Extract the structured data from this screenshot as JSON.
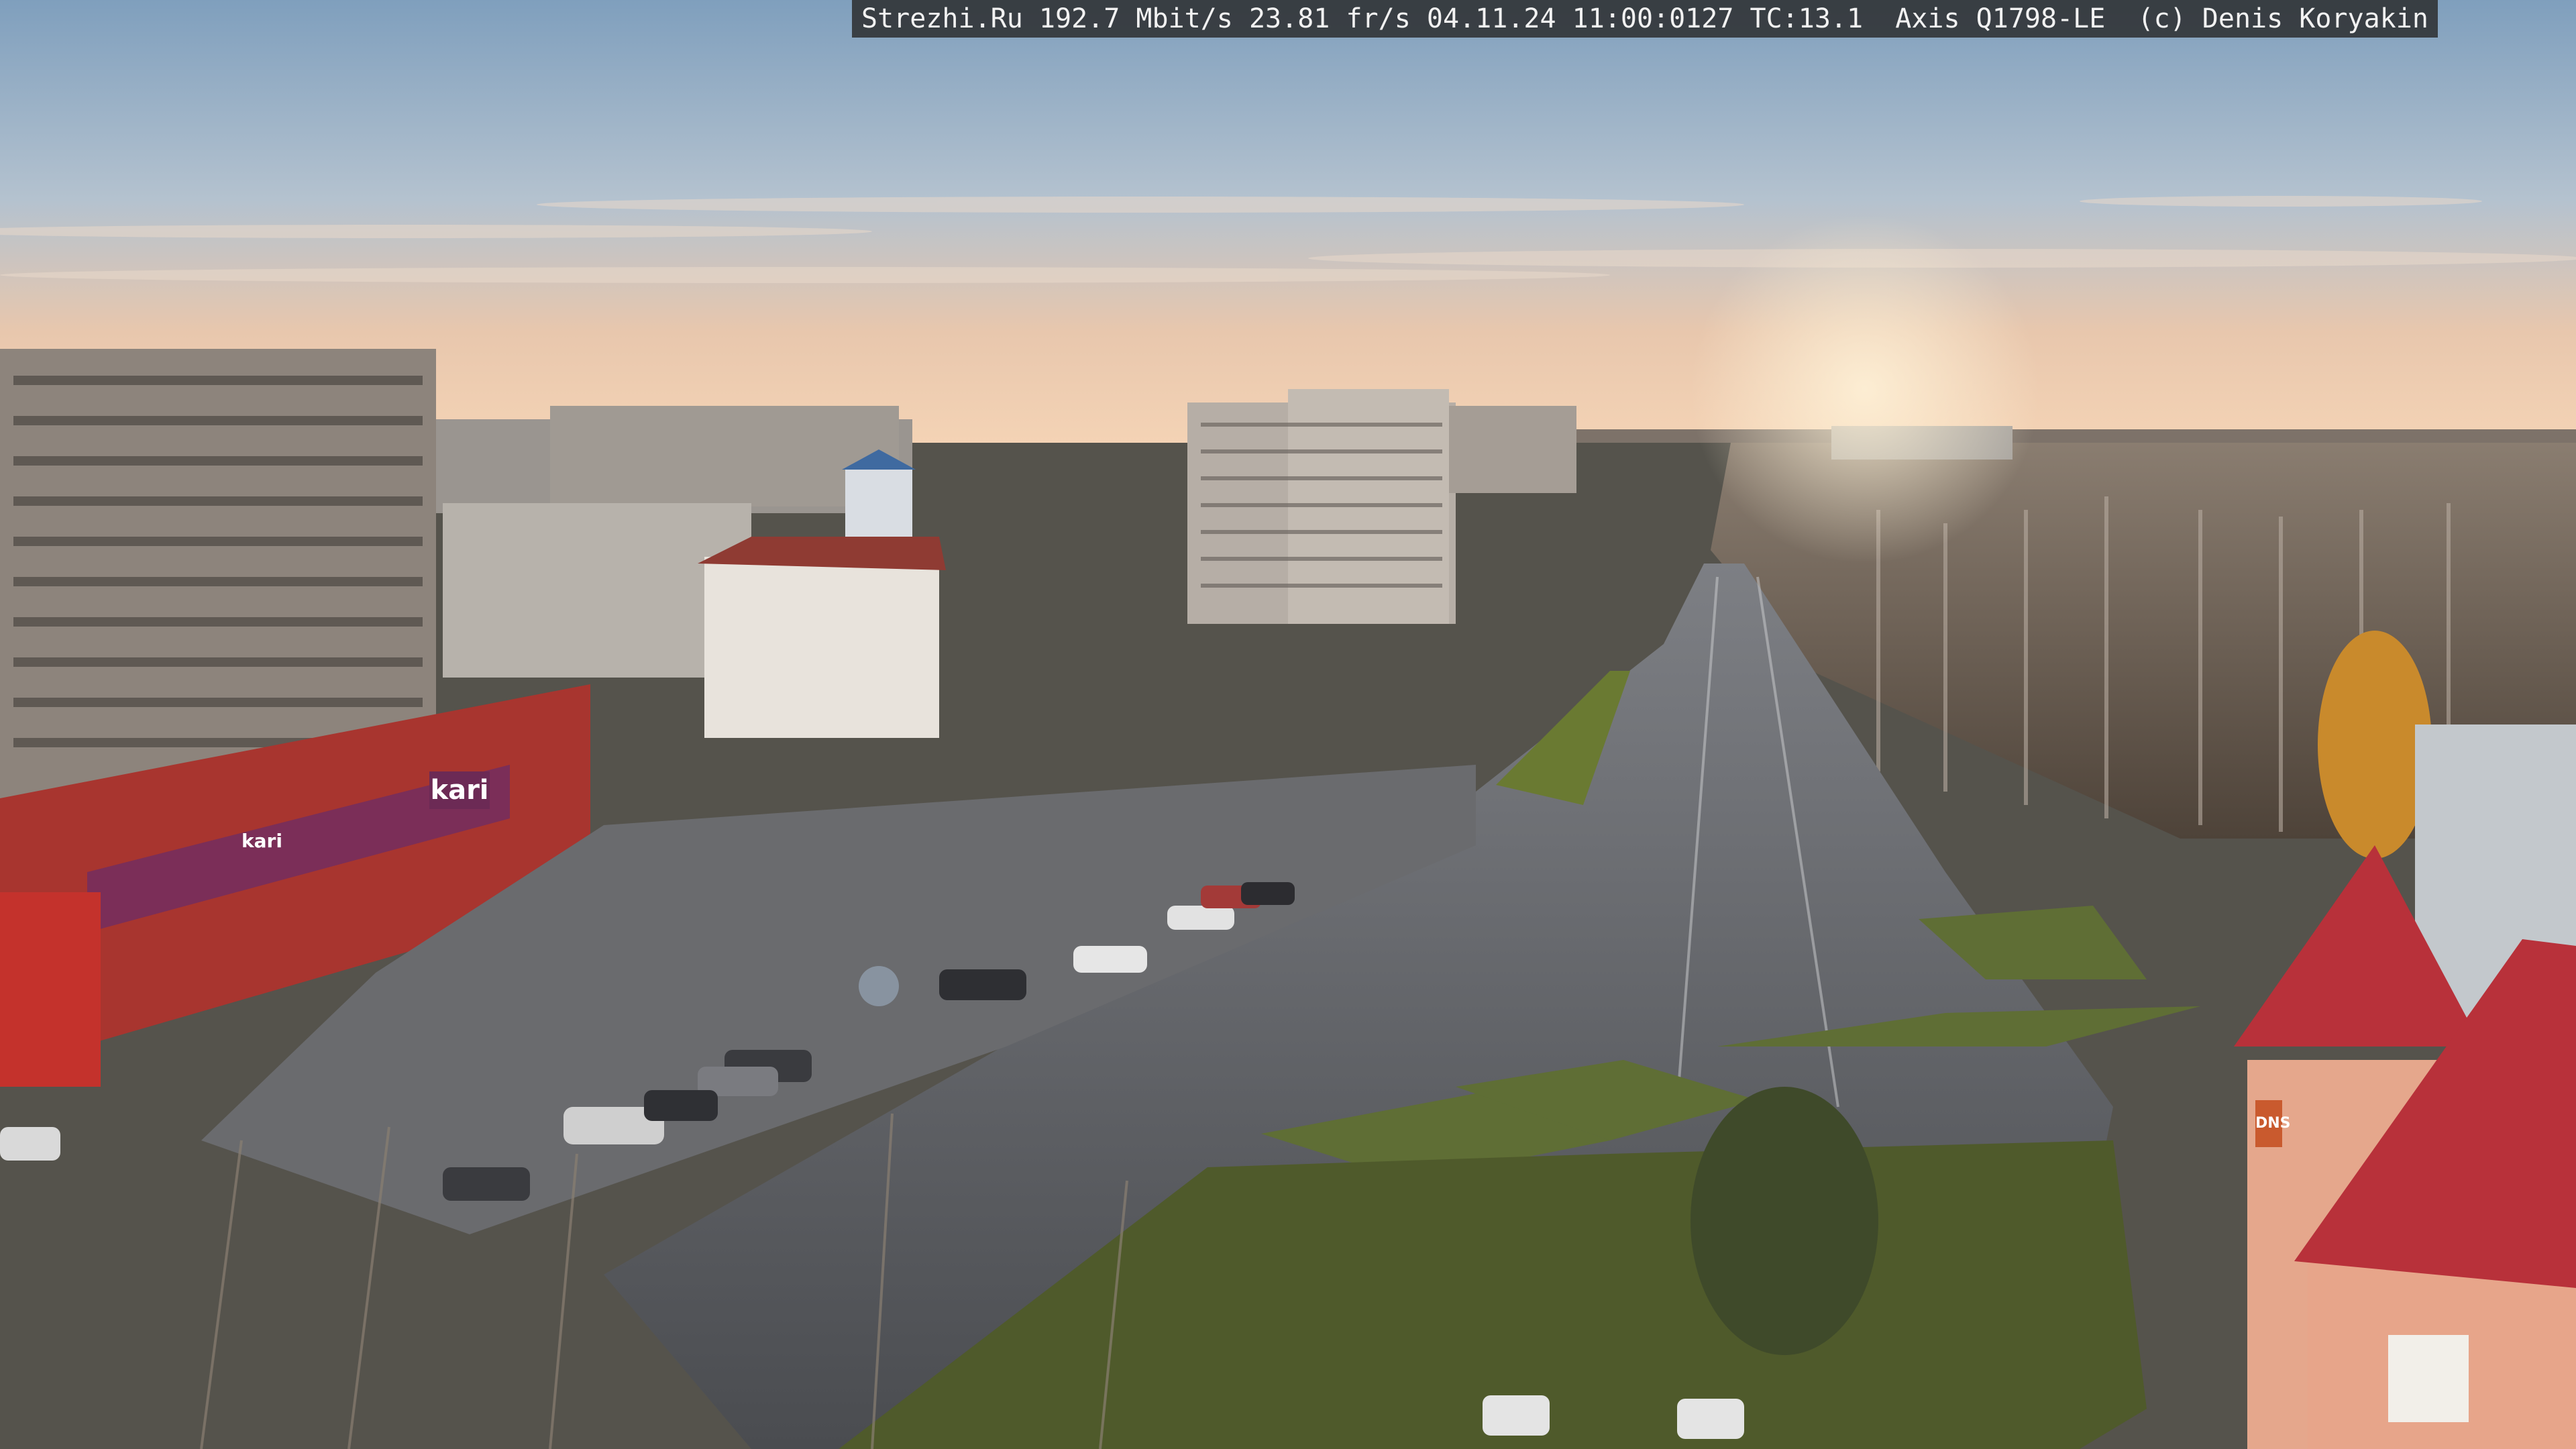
{
  "camera_overlay": {
    "text": "Strezhi.Ru 192.7 Mbit/s 23.81 fr/s 04.11.24 11:00:0127 TC:13.1  Axis Q1798-LE  (c) Denis Koryakin"
  },
  "signage": {
    "store_sign_large": "kari",
    "store_sign_facade": "kari",
    "building_sign_right": "DNS"
  },
  "colors": {
    "sky_top": "#8fb0cc",
    "sky_horizon": "#f4c9a6",
    "road": "#6b6e72",
    "grass": "#5c6a34",
    "brick_facade": "#a8352f",
    "roof_red": "#b8313a"
  }
}
